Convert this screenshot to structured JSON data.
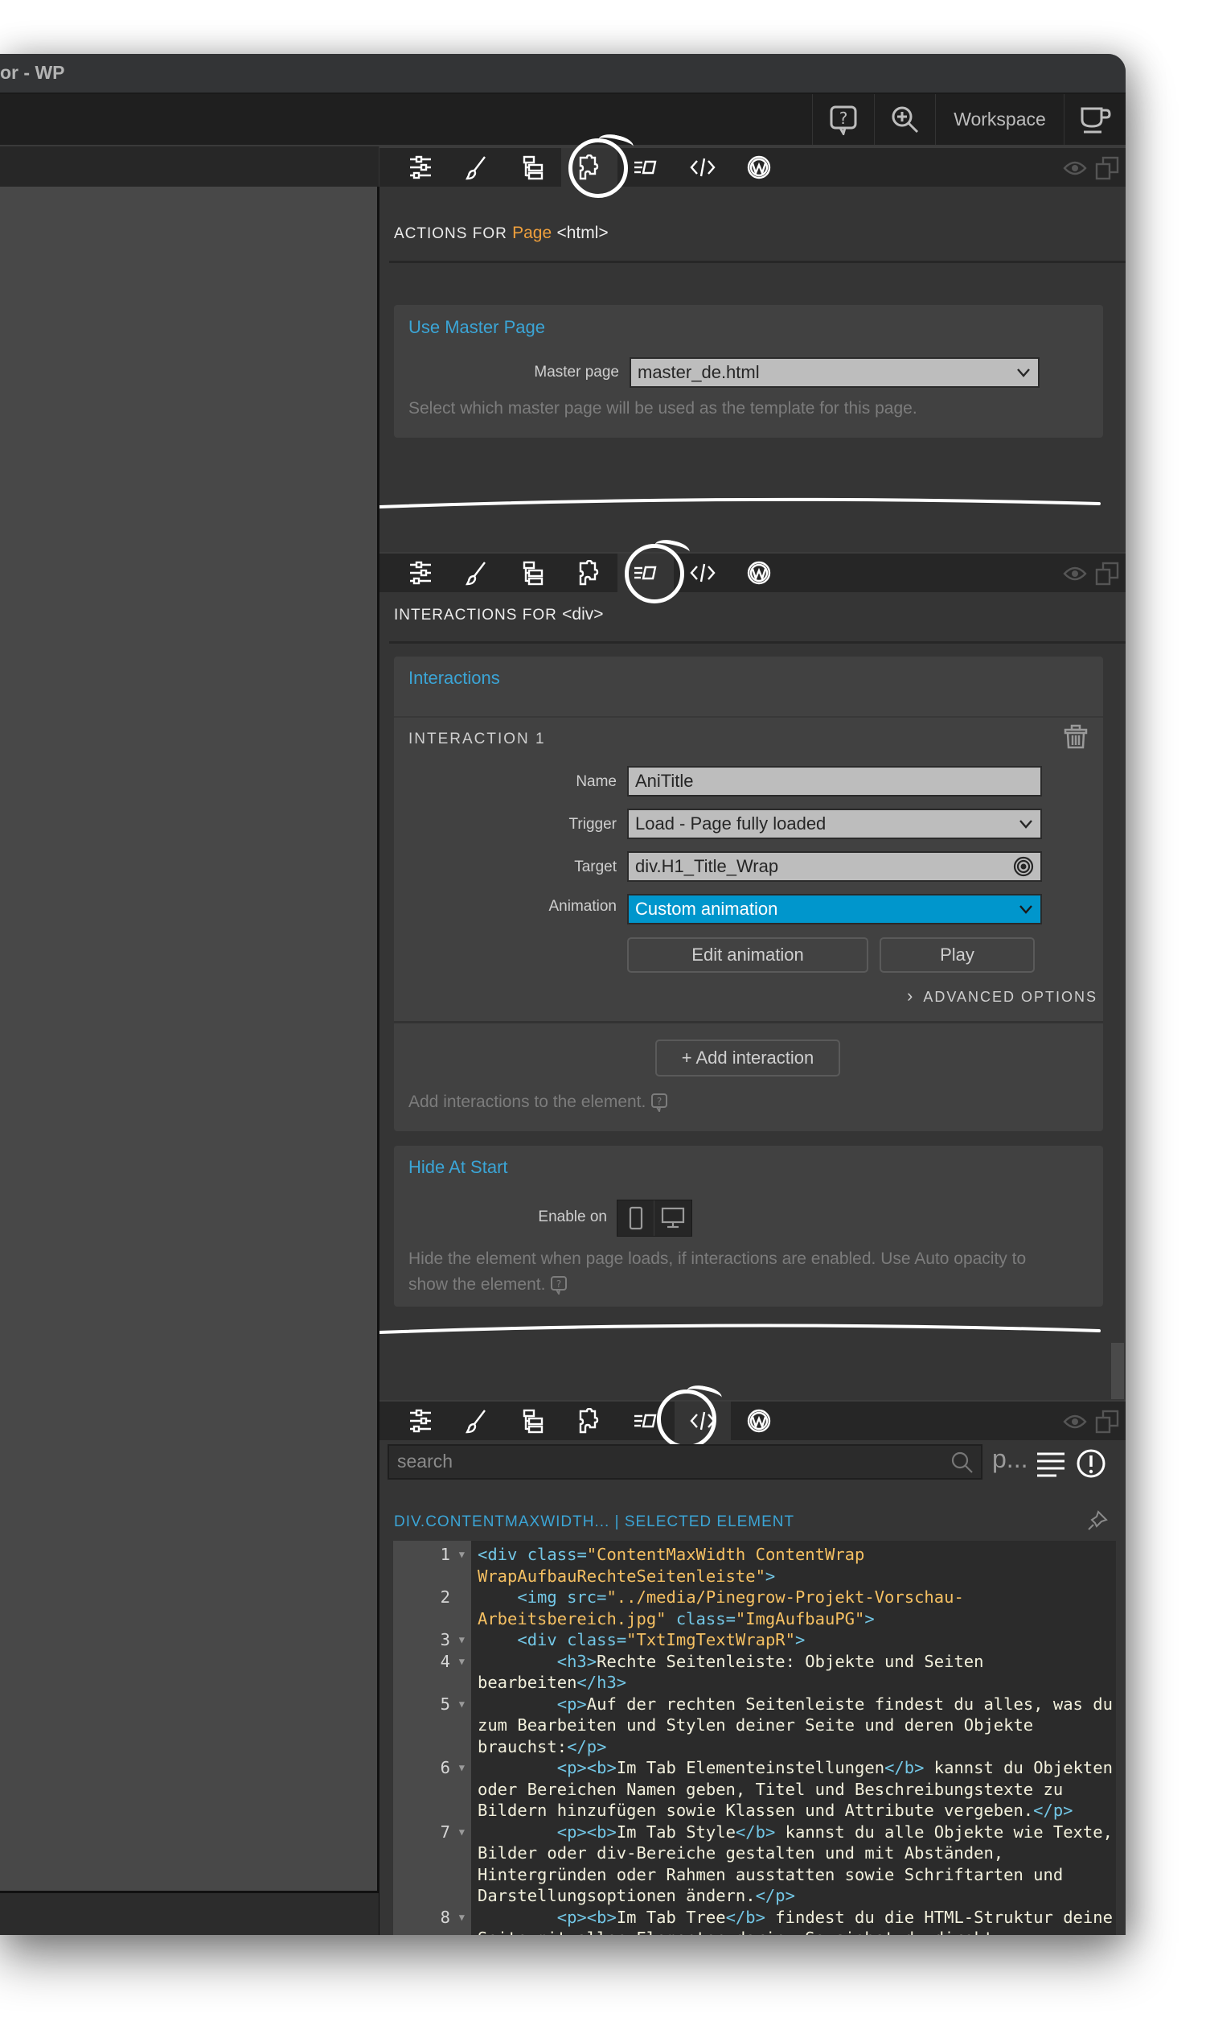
{
  "window": {
    "title": "or - WP"
  },
  "toolbar": {
    "help_icon": "help-bubble-icon",
    "zoom_icon": "zoom-in-icon",
    "workspace_label": "Workspace",
    "cup_icon": "coffee-cup-icon"
  },
  "tabs": [
    {
      "name": "element-settings",
      "icon": "sliders-icon"
    },
    {
      "name": "style",
      "icon": "brush-icon"
    },
    {
      "name": "tree",
      "icon": "tree-icon"
    },
    {
      "name": "actions",
      "icon": "puzzle-icon"
    },
    {
      "name": "interactions",
      "icon": "interactions-icon"
    },
    {
      "name": "code",
      "icon": "code-icon"
    },
    {
      "name": "wordpress",
      "icon": "wordpress-icon"
    }
  ],
  "panel_actions": {
    "active_tab": "actions",
    "head_prefix": "ACTIONS FOR",
    "head_target": "Page",
    "head_tag": "<html>",
    "card": {
      "title": "Use Master Page",
      "field_label": "Master page",
      "field_value": "master_de.html",
      "hint": "Select which master page will be used as the template for this page."
    }
  },
  "panel_interactions": {
    "active_tab": "interactions",
    "head_prefix": "INTERACTIONS FOR",
    "head_tag": "<div>",
    "card_title": "Interactions",
    "interaction": {
      "title": "INTERACTION 1",
      "name_label": "Name",
      "name_value": "AniTitle",
      "trigger_label": "Trigger",
      "trigger_value": "Load - Page fully loaded",
      "target_label": "Target",
      "target_value": "div.H1_Title_Wrap",
      "animation_label": "Animation",
      "animation_value": "Custom animation",
      "edit_button": "Edit animation",
      "play_button": "Play",
      "advanced_label": "ADVANCED OPTIONS"
    },
    "add_button": "+ Add interaction",
    "add_hint": "Add interactions to the element.",
    "hide_card": {
      "title": "Hide At Start",
      "enable_label": "Enable on",
      "hint": "Hide the element when page loads, if interactions are enabled. Use Auto opacity to show the element."
    }
  },
  "panel_code": {
    "active_tab": "code",
    "search_placeholder": "search",
    "search_value": "",
    "p_label": "p...",
    "breadcrumb": "DIV.CONTENTMAXWIDTH...",
    "separator": "|",
    "selected_label": "SELECTED ELEMENT",
    "lines": [
      {
        "n": "1",
        "fold": true,
        "segments": [
          {
            "t": "tag",
            "v": "<div "
          },
          {
            "t": "attr",
            "v": "class"
          },
          {
            "t": "tag",
            "v": "="
          },
          {
            "t": "str",
            "v": "\"ContentMaxWidth ContentWrap WrapAufbauRechteSeitenleiste\""
          },
          {
            "t": "tag",
            "v": ">"
          }
        ]
      },
      {
        "n": "2",
        "fold": false,
        "segments": [
          {
            "t": "txt",
            "v": "    "
          },
          {
            "t": "tag",
            "v": "<img "
          },
          {
            "t": "attr",
            "v": "src"
          },
          {
            "t": "tag",
            "v": "="
          },
          {
            "t": "str",
            "v": "\"../media/Pinegrow-Projekt-Vorschau-Arbeitsbereich.jpg\""
          },
          {
            "t": "txt",
            "v": " "
          },
          {
            "t": "attr",
            "v": "class"
          },
          {
            "t": "tag",
            "v": "="
          },
          {
            "t": "str",
            "v": "\"ImgAufbauPG\""
          },
          {
            "t": "tag",
            "v": ">"
          }
        ]
      },
      {
        "n": "3",
        "fold": true,
        "segments": [
          {
            "t": "txt",
            "v": "    "
          },
          {
            "t": "tag",
            "v": "<div "
          },
          {
            "t": "attr",
            "v": "class"
          },
          {
            "t": "tag",
            "v": "="
          },
          {
            "t": "str",
            "v": "\"TxtImgTextWrapR\""
          },
          {
            "t": "tag",
            "v": ">"
          }
        ]
      },
      {
        "n": "4",
        "fold": true,
        "segments": [
          {
            "t": "txt",
            "v": "        "
          },
          {
            "t": "tag",
            "v": "<h3>"
          },
          {
            "t": "txt",
            "v": "Rechte Seitenleiste: Objekte und Seiten bearbeiten"
          },
          {
            "t": "tag",
            "v": "</h3>"
          }
        ]
      },
      {
        "n": "5",
        "fold": true,
        "segments": [
          {
            "t": "txt",
            "v": "        "
          },
          {
            "t": "tag",
            "v": "<p>"
          },
          {
            "t": "txt",
            "v": "Auf der rechten Seitenleiste findest du alles, was du zum Bearbeiten und Stylen deiner Seite und deren Objekte brauchst:"
          },
          {
            "t": "tag",
            "v": "</p>"
          }
        ]
      },
      {
        "n": "6",
        "fold": true,
        "segments": [
          {
            "t": "txt",
            "v": "        "
          },
          {
            "t": "tag",
            "v": "<p><b>"
          },
          {
            "t": "txt",
            "v": "Im Tab Elementeinstellungen"
          },
          {
            "t": "tag",
            "v": "</b>"
          },
          {
            "t": "txt",
            "v": " kannst du Objekten oder Bereichen Namen geben, Titel und Beschreibungstexte zu Bildern hinzufügen sowie Klassen und Attribute vergeben."
          },
          {
            "t": "tag",
            "v": "</p>"
          }
        ]
      },
      {
        "n": "7",
        "fold": true,
        "segments": [
          {
            "t": "txt",
            "v": "        "
          },
          {
            "t": "tag",
            "v": "<p><b>"
          },
          {
            "t": "txt",
            "v": "Im Tab Style"
          },
          {
            "t": "tag",
            "v": "</b>"
          },
          {
            "t": "txt",
            "v": " kannst du alle Objekte wie Texte, Bilder oder div-Bereiche gestalten und mit Abständen, Hintergründen oder Rahmen ausstatten sowie Schriftarten und Darstellungsoptionen ändern."
          },
          {
            "t": "tag",
            "v": "</p>"
          }
        ]
      },
      {
        "n": "8",
        "fold": true,
        "segments": [
          {
            "t": "txt",
            "v": "        "
          },
          {
            "t": "tag",
            "v": "<p><b>"
          },
          {
            "t": "txt",
            "v": "Im Tab Tree"
          },
          {
            "t": "tag",
            "v": "</b>"
          },
          {
            "t": "txt",
            "v": " findest du die HTML-Struktur deine Seite mit allen Elementen darin. So siehst du direkt,"
          }
        ]
      }
    ]
  },
  "colors": {
    "accent_blue": "#3ba5d6",
    "selected_blue": "#0096cc",
    "orange": "#f0a03c",
    "code_tag": "#73c7e6",
    "code_string": "#f5c062"
  }
}
